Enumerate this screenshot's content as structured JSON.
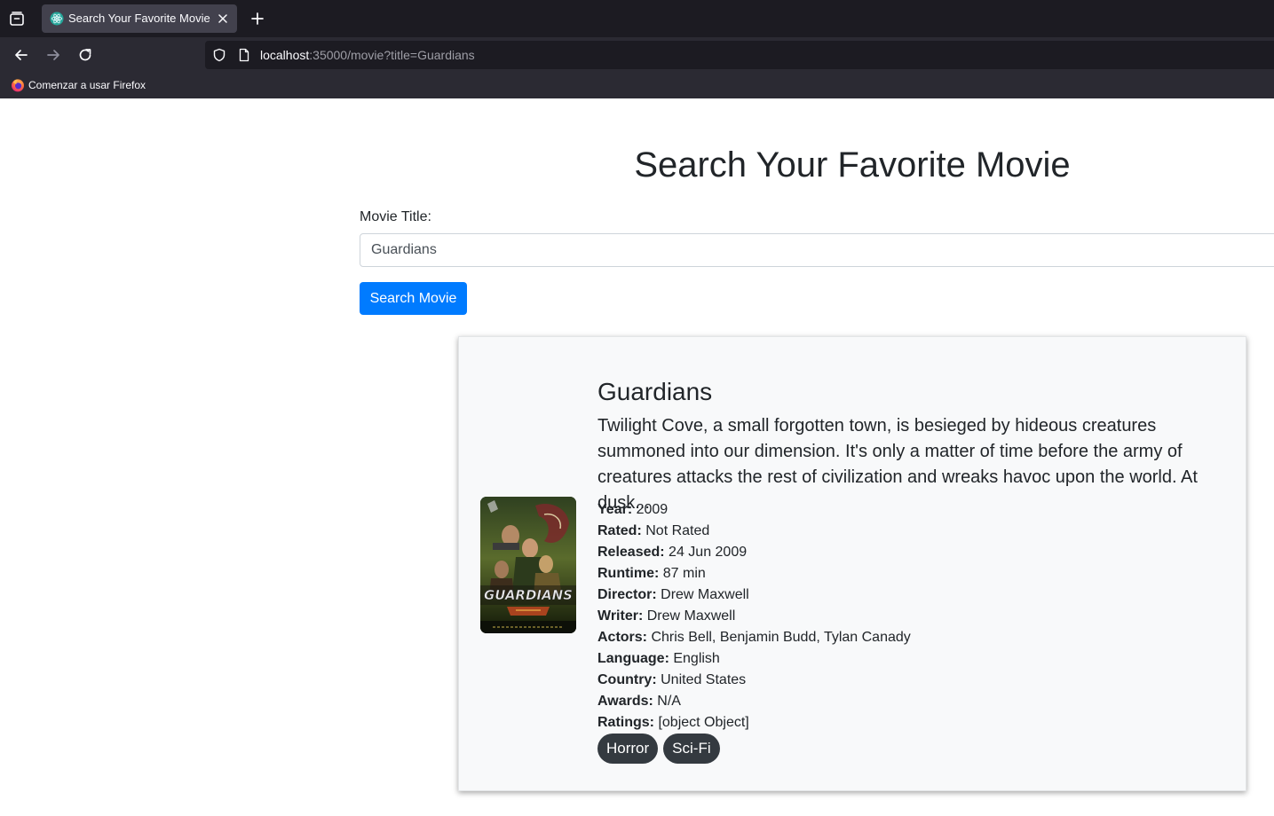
{
  "browser": {
    "tab": {
      "title": "Search Your Favorite Movie"
    },
    "url": {
      "host": "localhost",
      "rest": ":35000/movie?title=Guardians"
    },
    "bookmarks": [
      {
        "label": "Comenzar a usar Firefox"
      }
    ],
    "icons": [
      "tab-overview-icon",
      "react-favicon-icon",
      "close-icon",
      "plus-icon",
      "back-arrow-icon",
      "forward-arrow-icon",
      "reload-icon",
      "shield-icon",
      "page-icon",
      "firefox-icon"
    ]
  },
  "page": {
    "title": "Search Your Favorite Movie",
    "form": {
      "label": "Movie Title:",
      "input_value": "Guardians",
      "button_label": "Search Movie"
    },
    "movie": {
      "title": "Guardians",
      "plot": "Twilight Cove, a small forgotten town, is besieged by hideous creatures summoned into our dimension. It's only a matter of time before the army of creatures attacks the rest of civilization and wreaks havoc upon the world. At dusk...",
      "poster_text": "GUARDIANS",
      "details": [
        {
          "label": "Year:",
          "value": "2009"
        },
        {
          "label": "Rated:",
          "value": "Not Rated"
        },
        {
          "label": "Released:",
          "value": "24 Jun 2009"
        },
        {
          "label": "Runtime:",
          "value": "87 min"
        },
        {
          "label": "Director:",
          "value": "Drew Maxwell"
        },
        {
          "label": "Writer:",
          "value": "Drew Maxwell"
        },
        {
          "label": "Actors:",
          "value": "Chris Bell, Benjamin Budd, Tylan Canady"
        },
        {
          "label": "Language:",
          "value": "English"
        },
        {
          "label": "Country:",
          "value": "United States"
        },
        {
          "label": "Awards:",
          "value": "N/A"
        },
        {
          "label": "Ratings:",
          "value": "[object Object]"
        }
      ],
      "genres": [
        "Horror",
        "Sci-Fi"
      ]
    }
  },
  "colors": {
    "primary": "#007bff",
    "badge": "#343a40",
    "card_bg": "#f8f9fa",
    "text": "#212529"
  }
}
